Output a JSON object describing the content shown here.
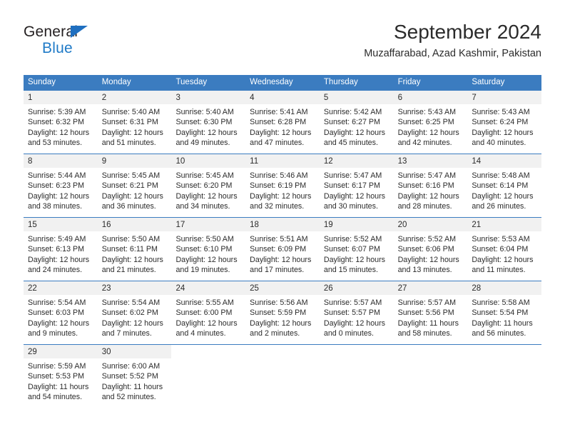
{
  "brand": {
    "line1": "General",
    "line2": "Blue",
    "triangle_color": "#1f6fc0",
    "line2_color": "#1f7ac7"
  },
  "header": {
    "title": "September 2024",
    "subtitle": "Muzaffarabad, Azad Kashmir, Pakistan"
  },
  "theme": {
    "header_bg": "#3b7cc0",
    "header_text": "#ffffff",
    "daynum_band": "#f1f1f1",
    "text": "#2b2b2b"
  },
  "weekdays": [
    "Sunday",
    "Monday",
    "Tuesday",
    "Wednesday",
    "Thursday",
    "Friday",
    "Saturday"
  ],
  "labels": {
    "sunrise": "Sunrise:",
    "sunset": "Sunset:",
    "daylight": "Daylight:"
  },
  "weeks": [
    [
      {
        "day": "1",
        "sunrise": "Sunrise: 5:39 AM",
        "sunset": "Sunset: 6:32 PM",
        "daylight1": "Daylight: 12 hours",
        "daylight2": "and 53 minutes."
      },
      {
        "day": "2",
        "sunrise": "Sunrise: 5:40 AM",
        "sunset": "Sunset: 6:31 PM",
        "daylight1": "Daylight: 12 hours",
        "daylight2": "and 51 minutes."
      },
      {
        "day": "3",
        "sunrise": "Sunrise: 5:40 AM",
        "sunset": "Sunset: 6:30 PM",
        "daylight1": "Daylight: 12 hours",
        "daylight2": "and 49 minutes."
      },
      {
        "day": "4",
        "sunrise": "Sunrise: 5:41 AM",
        "sunset": "Sunset: 6:28 PM",
        "daylight1": "Daylight: 12 hours",
        "daylight2": "and 47 minutes."
      },
      {
        "day": "5",
        "sunrise": "Sunrise: 5:42 AM",
        "sunset": "Sunset: 6:27 PM",
        "daylight1": "Daylight: 12 hours",
        "daylight2": "and 45 minutes."
      },
      {
        "day": "6",
        "sunrise": "Sunrise: 5:43 AM",
        "sunset": "Sunset: 6:25 PM",
        "daylight1": "Daylight: 12 hours",
        "daylight2": "and 42 minutes."
      },
      {
        "day": "7",
        "sunrise": "Sunrise: 5:43 AM",
        "sunset": "Sunset: 6:24 PM",
        "daylight1": "Daylight: 12 hours",
        "daylight2": "and 40 minutes."
      }
    ],
    [
      {
        "day": "8",
        "sunrise": "Sunrise: 5:44 AM",
        "sunset": "Sunset: 6:23 PM",
        "daylight1": "Daylight: 12 hours",
        "daylight2": "and 38 minutes."
      },
      {
        "day": "9",
        "sunrise": "Sunrise: 5:45 AM",
        "sunset": "Sunset: 6:21 PM",
        "daylight1": "Daylight: 12 hours",
        "daylight2": "and 36 minutes."
      },
      {
        "day": "10",
        "sunrise": "Sunrise: 5:45 AM",
        "sunset": "Sunset: 6:20 PM",
        "daylight1": "Daylight: 12 hours",
        "daylight2": "and 34 minutes."
      },
      {
        "day": "11",
        "sunrise": "Sunrise: 5:46 AM",
        "sunset": "Sunset: 6:19 PM",
        "daylight1": "Daylight: 12 hours",
        "daylight2": "and 32 minutes."
      },
      {
        "day": "12",
        "sunrise": "Sunrise: 5:47 AM",
        "sunset": "Sunset: 6:17 PM",
        "daylight1": "Daylight: 12 hours",
        "daylight2": "and 30 minutes."
      },
      {
        "day": "13",
        "sunrise": "Sunrise: 5:47 AM",
        "sunset": "Sunset: 6:16 PM",
        "daylight1": "Daylight: 12 hours",
        "daylight2": "and 28 minutes."
      },
      {
        "day": "14",
        "sunrise": "Sunrise: 5:48 AM",
        "sunset": "Sunset: 6:14 PM",
        "daylight1": "Daylight: 12 hours",
        "daylight2": "and 26 minutes."
      }
    ],
    [
      {
        "day": "15",
        "sunrise": "Sunrise: 5:49 AM",
        "sunset": "Sunset: 6:13 PM",
        "daylight1": "Daylight: 12 hours",
        "daylight2": "and 24 minutes."
      },
      {
        "day": "16",
        "sunrise": "Sunrise: 5:50 AM",
        "sunset": "Sunset: 6:11 PM",
        "daylight1": "Daylight: 12 hours",
        "daylight2": "and 21 minutes."
      },
      {
        "day": "17",
        "sunrise": "Sunrise: 5:50 AM",
        "sunset": "Sunset: 6:10 PM",
        "daylight1": "Daylight: 12 hours",
        "daylight2": "and 19 minutes."
      },
      {
        "day": "18",
        "sunrise": "Sunrise: 5:51 AM",
        "sunset": "Sunset: 6:09 PM",
        "daylight1": "Daylight: 12 hours",
        "daylight2": "and 17 minutes."
      },
      {
        "day": "19",
        "sunrise": "Sunrise: 5:52 AM",
        "sunset": "Sunset: 6:07 PM",
        "daylight1": "Daylight: 12 hours",
        "daylight2": "and 15 minutes."
      },
      {
        "day": "20",
        "sunrise": "Sunrise: 5:52 AM",
        "sunset": "Sunset: 6:06 PM",
        "daylight1": "Daylight: 12 hours",
        "daylight2": "and 13 minutes."
      },
      {
        "day": "21",
        "sunrise": "Sunrise: 5:53 AM",
        "sunset": "Sunset: 6:04 PM",
        "daylight1": "Daylight: 12 hours",
        "daylight2": "and 11 minutes."
      }
    ],
    [
      {
        "day": "22",
        "sunrise": "Sunrise: 5:54 AM",
        "sunset": "Sunset: 6:03 PM",
        "daylight1": "Daylight: 12 hours",
        "daylight2": "and 9 minutes."
      },
      {
        "day": "23",
        "sunrise": "Sunrise: 5:54 AM",
        "sunset": "Sunset: 6:02 PM",
        "daylight1": "Daylight: 12 hours",
        "daylight2": "and 7 minutes."
      },
      {
        "day": "24",
        "sunrise": "Sunrise: 5:55 AM",
        "sunset": "Sunset: 6:00 PM",
        "daylight1": "Daylight: 12 hours",
        "daylight2": "and 4 minutes."
      },
      {
        "day": "25",
        "sunrise": "Sunrise: 5:56 AM",
        "sunset": "Sunset: 5:59 PM",
        "daylight1": "Daylight: 12 hours",
        "daylight2": "and 2 minutes."
      },
      {
        "day": "26",
        "sunrise": "Sunrise: 5:57 AM",
        "sunset": "Sunset: 5:57 PM",
        "daylight1": "Daylight: 12 hours",
        "daylight2": "and 0 minutes."
      },
      {
        "day": "27",
        "sunrise": "Sunrise: 5:57 AM",
        "sunset": "Sunset: 5:56 PM",
        "daylight1": "Daylight: 11 hours",
        "daylight2": "and 58 minutes."
      },
      {
        "day": "28",
        "sunrise": "Sunrise: 5:58 AM",
        "sunset": "Sunset: 5:54 PM",
        "daylight1": "Daylight: 11 hours",
        "daylight2": "and 56 minutes."
      }
    ],
    [
      {
        "day": "29",
        "sunrise": "Sunrise: 5:59 AM",
        "sunset": "Sunset: 5:53 PM",
        "daylight1": "Daylight: 11 hours",
        "daylight2": "and 54 minutes."
      },
      {
        "day": "30",
        "sunrise": "Sunrise: 6:00 AM",
        "sunset": "Sunset: 5:52 PM",
        "daylight1": "Daylight: 11 hours",
        "daylight2": "and 52 minutes."
      },
      {
        "day": "",
        "sunrise": "",
        "sunset": "",
        "daylight1": "",
        "daylight2": ""
      },
      {
        "day": "",
        "sunrise": "",
        "sunset": "",
        "daylight1": "",
        "daylight2": ""
      },
      {
        "day": "",
        "sunrise": "",
        "sunset": "",
        "daylight1": "",
        "daylight2": ""
      },
      {
        "day": "",
        "sunrise": "",
        "sunset": "",
        "daylight1": "",
        "daylight2": ""
      },
      {
        "day": "",
        "sunrise": "",
        "sunset": "",
        "daylight1": "",
        "daylight2": ""
      }
    ]
  ]
}
